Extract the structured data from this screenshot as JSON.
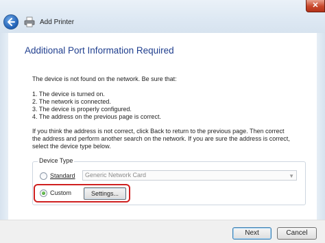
{
  "window": {
    "close_label": "✕",
    "title": "Add Printer",
    "back_icon": "back-arrow-icon",
    "printer_icon": "printer-icon"
  },
  "main": {
    "heading": "Additional Port Information Required",
    "intro": "The device is not found on the network.  Be sure that:",
    "checklist": [
      "1.   The device is turned on.",
      "2.   The network is connected.",
      "3.   The device is properly configured.",
      "4.   The address on the previous page is correct."
    ],
    "help_lines": [
      "If you think the address is not correct, click Back to return to the previous page.  Then correct",
      "the address and perform another search on the network.  If you are sure the address is correct,",
      "select the device type below."
    ]
  },
  "device_type": {
    "group_label": "Device Type",
    "standard_label": "Standard",
    "standard_selected": false,
    "standard_value": "Generic Network Card",
    "custom_label": "Custom",
    "custom_selected": true,
    "settings_label": "Settings..."
  },
  "footer": {
    "next_label": "Next",
    "cancel_label": "Cancel"
  },
  "colors": {
    "heading": "#1f3e8e",
    "highlight": "#cf1f1f"
  }
}
